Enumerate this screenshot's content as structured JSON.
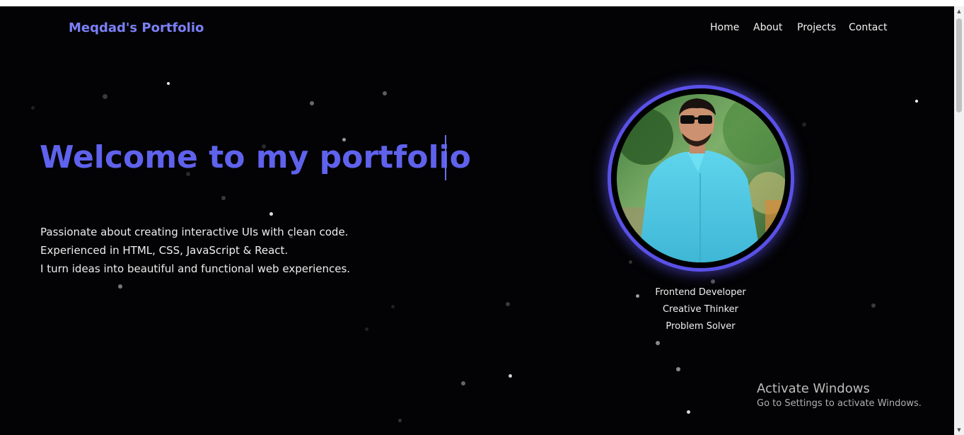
{
  "header": {
    "brand": "Meqdad's Portfolio",
    "nav": [
      "Home",
      "About",
      "Projects",
      "Contact"
    ]
  },
  "hero": {
    "headline": "Welcome to my portfolio",
    "description": [
      "Passionate about creating interactive UIs with clean code.",
      "Experienced in HTML, CSS, JavaScript & React.",
      "I turn ideas into beautiful and functional web experiences."
    ]
  },
  "profile": {
    "roles": [
      "Frontend Developer",
      "Creative Thinker",
      "Problem Solver"
    ]
  },
  "windows_watermark": {
    "title": "Activate Windows",
    "subtitle": "Go to Settings to activate Windows."
  },
  "colors": {
    "accent": "#5f62ec",
    "brand": "#7b80f6",
    "ring": "#5a51e8",
    "background": "#030305"
  }
}
